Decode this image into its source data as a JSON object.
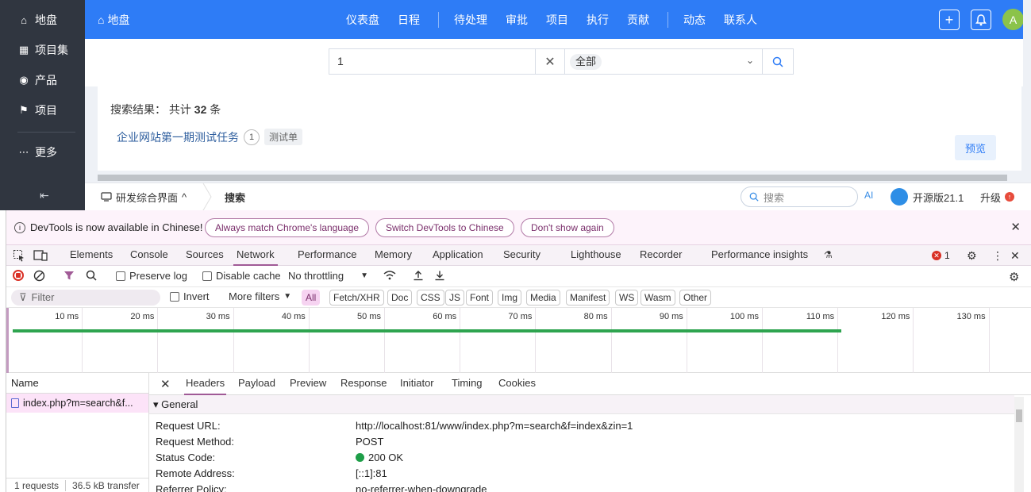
{
  "sidebar": {
    "items": [
      {
        "label": "地盘",
        "icon": "home-icon",
        "glyph": "⌂"
      },
      {
        "label": "项目集",
        "icon": "grid-icon",
        "glyph": "▦"
      },
      {
        "label": "产品",
        "icon": "lightbulb-icon",
        "glyph": "◉"
      },
      {
        "label": "项目",
        "icon": "rocket-icon",
        "glyph": "⚑"
      }
    ],
    "more": {
      "label": "更多",
      "icon": "more-dots-icon",
      "glyph": "⋯"
    },
    "collapse_glyph": "⇤"
  },
  "topbar": {
    "home_label": "地盘",
    "home_glyph": "⌂",
    "nav": [
      "仪表盘",
      "日程",
      "待处理",
      "审批",
      "项目",
      "执行",
      "贡献",
      "动态",
      "联系人"
    ],
    "add_glyph": "+",
    "bell_glyph": "🔔",
    "avatar": "A"
  },
  "search": {
    "value": "1",
    "clear_glyph": "✕",
    "scope": "全部",
    "caret": "⌄"
  },
  "results": {
    "label": "搜索结果：",
    "total_prefix": "共计",
    "total": "32",
    "total_suffix": "条",
    "item": {
      "title": "企业网站第一期测试任务",
      "badge": "1",
      "type": "测试单"
    },
    "preview": "预览"
  },
  "appbar": {
    "crumb1": "研发综合界面",
    "crumb1_caret": "^",
    "crumb2": "搜索",
    "search_placeholder": "搜索",
    "ai_label": "AI",
    "version": "开源版21.1",
    "upgrade": "升级",
    "upgrade_badge": "↑"
  },
  "devtools": {
    "info": {
      "message": "DevTools is now available in Chinese!",
      "buttons": [
        "Always match Chrome's language",
        "Switch DevTools to Chinese",
        "Don't show again"
      ],
      "close": "✕"
    },
    "tabs": [
      "Elements",
      "Console",
      "Sources",
      "Network",
      "Performance",
      "Memory",
      "Application",
      "Security",
      "Lighthouse",
      "Recorder",
      "Performance insights"
    ],
    "active_tab": "Network",
    "error_count": "1",
    "toolbar": {
      "preserve_log": "Preserve log",
      "disable_cache": "Disable cache",
      "throttling": "No throttling"
    },
    "filter": {
      "placeholder": "Filter",
      "invert": "Invert",
      "more_filters": "More filters",
      "types": [
        "All",
        "Fetch/XHR",
        "Doc",
        "CSS",
        "JS",
        "Font",
        "Img",
        "Media",
        "Manifest",
        "WS",
        "Wasm",
        "Other"
      ]
    },
    "timeline": {
      "ticks": [
        "10 ms",
        "20 ms",
        "30 ms",
        "40 ms",
        "50 ms",
        "60 ms",
        "70 ms",
        "80 ms",
        "90 ms",
        "100 ms",
        "110 ms",
        "120 ms",
        "130 ms"
      ],
      "bar_end_ms": 110.5,
      "bar_color": "#2ea44f"
    },
    "requests": {
      "header": "Name",
      "rows": [
        "index.php?m=search&f..."
      ],
      "footer_count": "1 requests",
      "footer_transfer": "36.5 kB transfer"
    },
    "detail": {
      "tabs": [
        "Headers",
        "Payload",
        "Preview",
        "Response",
        "Initiator",
        "Timing",
        "Cookies"
      ],
      "active": "Headers",
      "section": "▾ General",
      "rows": [
        {
          "k": "Request URL:",
          "v": "http://localhost:81/www/index.php?m=search&f=index&zin=1"
        },
        {
          "k": "Request Method:",
          "v": "POST"
        },
        {
          "k": "Status Code:",
          "v": "200 OK"
        },
        {
          "k": "Remote Address:",
          "v": "[::1]:81"
        },
        {
          "k": "Referrer Policy:",
          "v": "no-referrer-when-downgrade"
        }
      ]
    }
  },
  "colors": {
    "accent": "#2e7cf6",
    "sidebar": "#303640",
    "devtools_accent": "#a05a96"
  }
}
